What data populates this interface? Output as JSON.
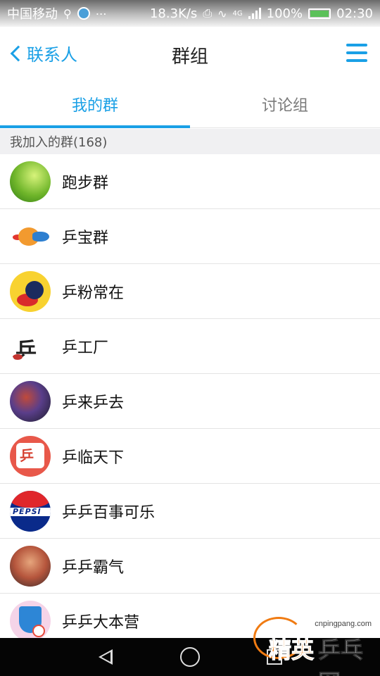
{
  "status_bar": {
    "carrier": "中国移动",
    "speed": "18.3K/s",
    "network": "4G",
    "battery": "100%",
    "time": "02:30",
    "icons": [
      "search-icon",
      "app-icon",
      "more-icon",
      "vibrate-icon",
      "wifi-icon",
      "signal-icon",
      "battery-icon"
    ]
  },
  "header": {
    "back_label": "联系人",
    "title": "群组",
    "accent_color": "#1aa0e6"
  },
  "tabs": [
    {
      "label": "我的群",
      "active": true
    },
    {
      "label": "讨论组",
      "active": false
    }
  ],
  "section": {
    "title": "我加入的群(168)"
  },
  "groups": [
    {
      "name": "跑步群"
    },
    {
      "name": "乒宝群"
    },
    {
      "name": "乒粉常在"
    },
    {
      "name": "乒工厂"
    },
    {
      "name": "乒来乒去"
    },
    {
      "name": "乒临天下"
    },
    {
      "name": "乒乒百事可乐"
    },
    {
      "name": "乒乒霸气"
    },
    {
      "name": "乒乒大本营"
    }
  ],
  "avatar_labels": {
    "pingongchang": "乒",
    "pinlin": "乒",
    "pepsi": "PEPSI"
  },
  "watermark": {
    "url": "cnpingpang.com",
    "text_orange": "精英",
    "text_white": "乒乓网"
  }
}
